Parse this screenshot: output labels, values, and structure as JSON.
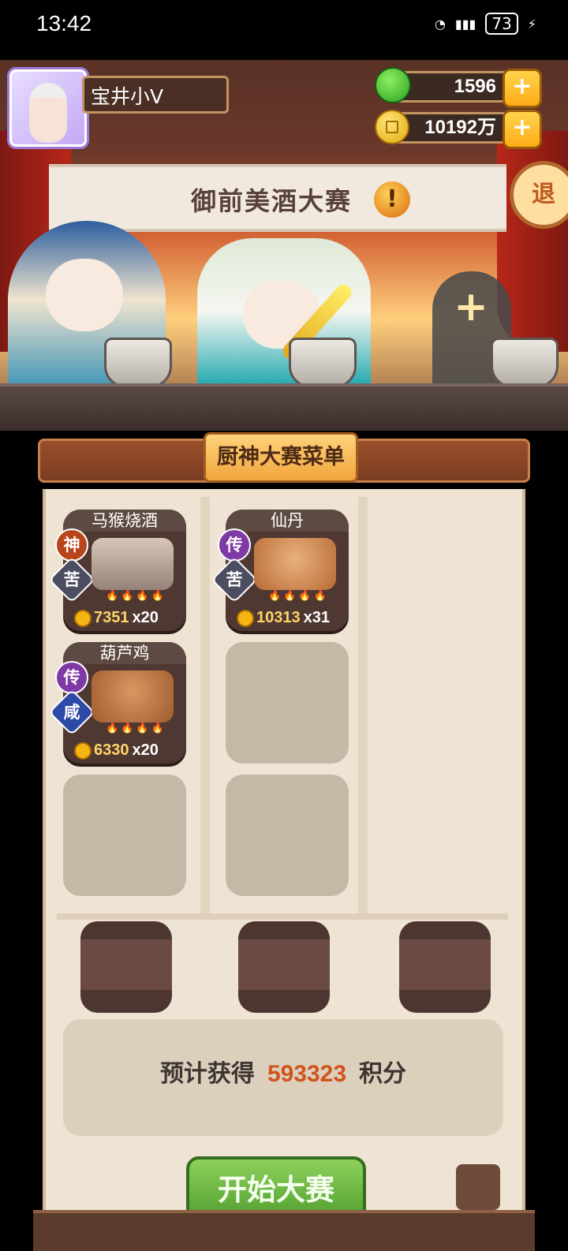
{
  "status_bar": {
    "time": "13:42",
    "battery": "73"
  },
  "player": {
    "name": "宝井小V"
  },
  "currency": {
    "jade": "1596",
    "coins": "10192万"
  },
  "stage": {
    "exit_label": "退",
    "title": "御前美酒大赛",
    "alert": "!",
    "slot_plus": "+"
  },
  "menu": {
    "title": "厨神大赛菜单",
    "dishes": [
      {
        "name": "马猴烧酒",
        "rarity": "神",
        "flavor": "苦",
        "price": "7351",
        "multiplier": "x20"
      },
      {
        "name": "仙丹",
        "rarity": "传",
        "flavor": "苦",
        "price": "10313",
        "multiplier": "x31"
      },
      {
        "name": "葫芦鸡",
        "rarity": "传",
        "flavor": "咸",
        "price": "6330",
        "multiplier": "x20"
      }
    ]
  },
  "score": {
    "prefix": "预计获得",
    "value": "593323",
    "suffix": "积分"
  },
  "start_button": "开始大赛"
}
